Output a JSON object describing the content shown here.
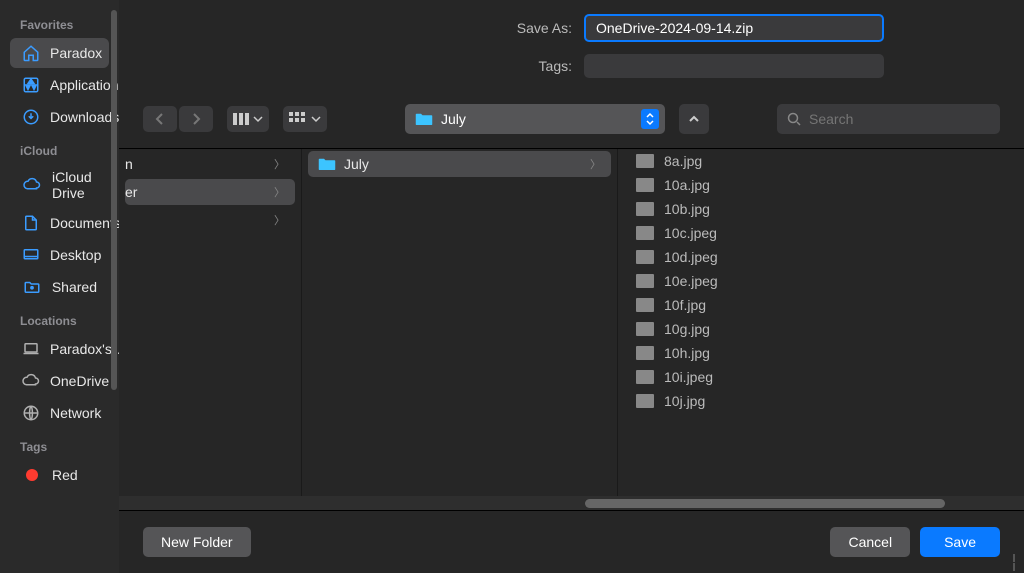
{
  "save_as_label": "Save As:",
  "filename": "OneDrive-2024-09-14.zip",
  "tags_label": "Tags:",
  "path_current": "July",
  "search_placeholder": "Search",
  "sidebar": {
    "sections": [
      {
        "header": "Favorites",
        "items": [
          {
            "icon": "house",
            "label": "Paradox",
            "selected": true
          },
          {
            "icon": "applications",
            "label": "Applications"
          },
          {
            "icon": "downloads",
            "label": "Downloads"
          }
        ]
      },
      {
        "header": "iCloud",
        "items": [
          {
            "icon": "cloud",
            "label": "iCloud Drive"
          },
          {
            "icon": "document",
            "label": "Documents"
          },
          {
            "icon": "desktop",
            "label": "Desktop"
          },
          {
            "icon": "shared",
            "label": "Shared"
          }
        ]
      },
      {
        "header": "Locations",
        "items": [
          {
            "icon": "laptop",
            "label": "Paradox's…"
          },
          {
            "icon": "cloud",
            "label": "OneDrive"
          },
          {
            "icon": "network",
            "label": "Network"
          }
        ]
      },
      {
        "header": "Tags",
        "items": [
          {
            "icon": "red-dot",
            "label": "Red"
          }
        ]
      }
    ]
  },
  "col1": [
    {
      "label": "n",
      "chevron": true
    },
    {
      "label": "er",
      "chevron": true,
      "selected": true
    },
    {
      "label": "",
      "chevron": true
    }
  ],
  "col2": [
    {
      "label": "July",
      "chevron": true,
      "selected": true,
      "folder": true
    }
  ],
  "files": [
    "8a.jpg",
    "10a.jpg",
    "10b.jpg",
    "10c.jpeg",
    "10d.jpeg",
    "10e.jpeg",
    "10f.jpg",
    "10g.jpg",
    "10h.jpg",
    "10i.jpeg",
    "10j.jpg"
  ],
  "footer": {
    "new_folder": "New Folder",
    "cancel": "Cancel",
    "save": "Save"
  },
  "colors": {
    "accent": "#0a7aff",
    "icon": "#3b9cff"
  }
}
